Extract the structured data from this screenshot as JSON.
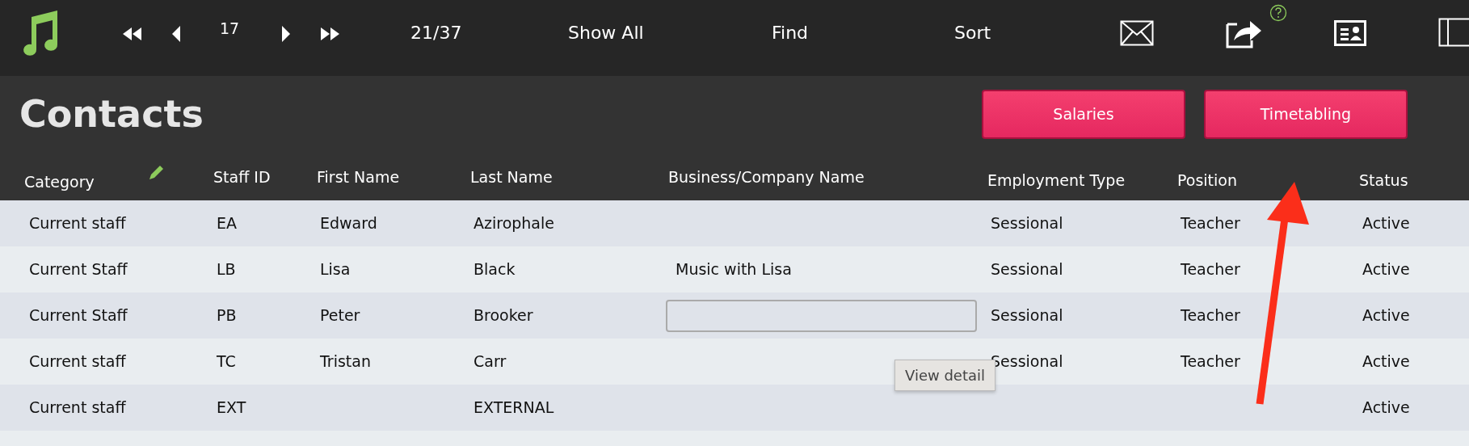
{
  "toolbar": {
    "record_number": "17",
    "record_count": "21/37",
    "actions": [
      "Show All",
      "Find",
      "Sort"
    ]
  },
  "title": "Contacts",
  "buttons": [
    "Salaries",
    "Timetabling"
  ],
  "table": {
    "columns": [
      "Category",
      "Staff ID",
      "First Name",
      "Last Name",
      "Business/Company Name",
      "Employment Type",
      "Position",
      "Status"
    ],
    "rows": [
      {
        "category": "Current staff",
        "staff_id": "EA",
        "first_name": "Edward",
        "last_name": "Azirophale",
        "editing": false,
        "employment_type": "Sessional",
        "position": "Teacher",
        "status": "Active"
      },
      {
        "category": "Current Staff",
        "staff_id": "LB",
        "first_name": "Lisa",
        "last_name": "Black",
        "business": "Music with Lisa",
        "editing": false,
        "employment_type": "Sessional",
        "position": "Teacher",
        "status": "Active"
      },
      {
        "category": "Current Staff",
        "staff_id": "PB",
        "first_name": "Peter",
        "last_name": "Brooker",
        "editing": true,
        "employment_type": "Sessional",
        "position": "Teacher",
        "status": "Active"
      },
      {
        "category": "Current staff",
        "staff_id": "TC",
        "first_name": "Tristan",
        "last_name": "Carr",
        "editing": false,
        "employment_type": "Sessional",
        "position": "Teacher",
        "status": "Active"
      },
      {
        "category": "Current staff",
        "staff_id": "EXT",
        "last_name": "EXTERNAL",
        "editing": false,
        "status": "Active"
      }
    ]
  },
  "tooltip": "View detail"
}
